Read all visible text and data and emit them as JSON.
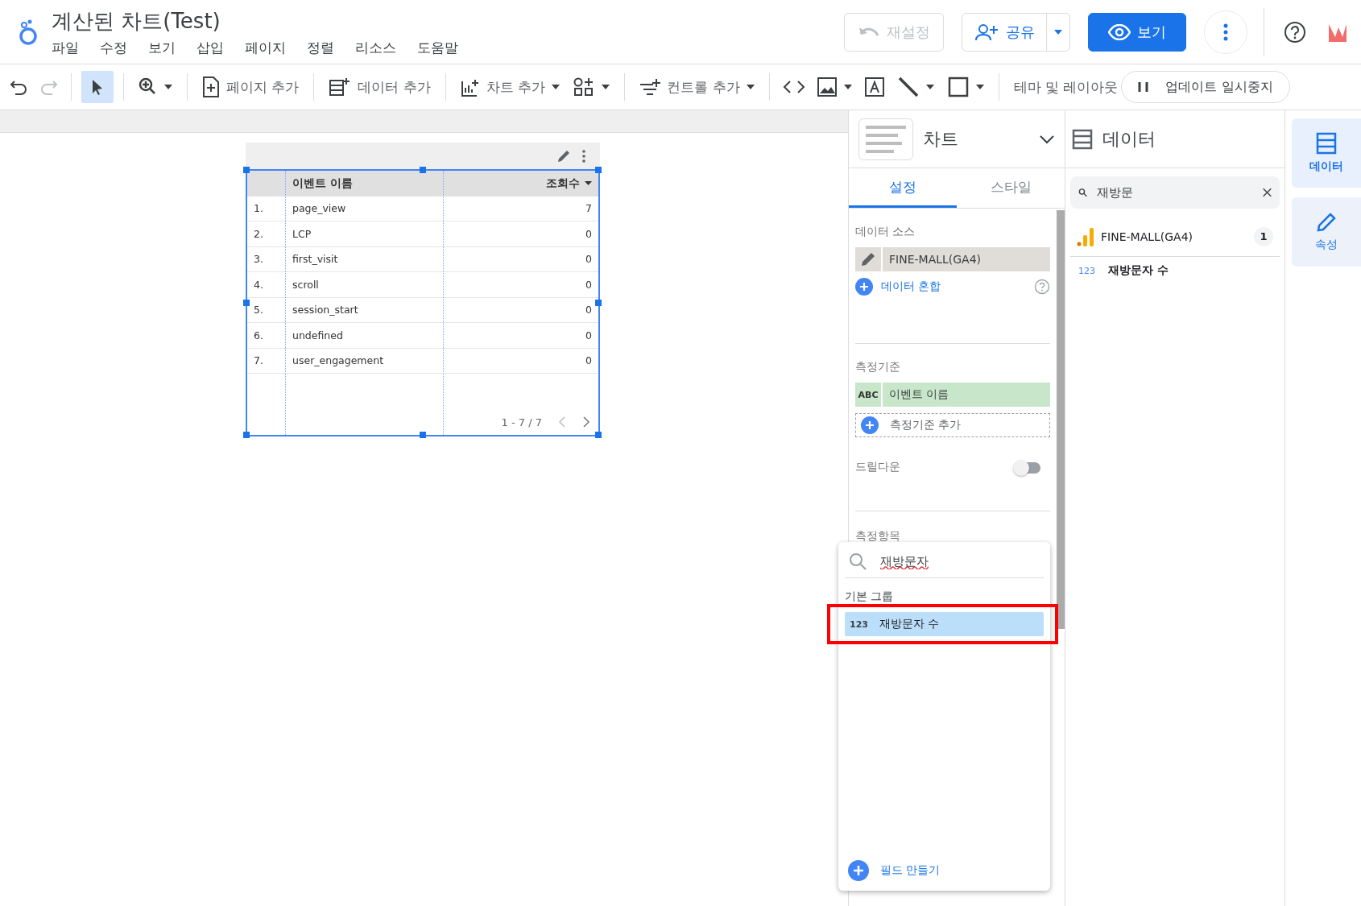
{
  "app": {
    "title": "계산된 차트(Test)",
    "menu": [
      "파일",
      "수정",
      "보기",
      "삽입",
      "페이지",
      "정렬",
      "리소스",
      "도움말"
    ]
  },
  "header_buttons": {
    "reset": "재설정",
    "share": "공유",
    "view": "보기"
  },
  "toolbar": {
    "page_add": "페이지 추가",
    "data_add": "데이터 추가",
    "chart_add": "차트 추가",
    "control_add": "컨트롤 추가",
    "theme": "테마 및 레이아웃",
    "pause": "업데이트 일시중지"
  },
  "table": {
    "selected": true,
    "columns": [
      {
        "label": "이벤트 이름",
        "sorted": false
      },
      {
        "label": "조회수",
        "sorted": true
      }
    ],
    "rows": [
      {
        "index": "1.",
        "name": "page_view",
        "value": "7"
      },
      {
        "index": "2.",
        "name": "LCP",
        "value": "0"
      },
      {
        "index": "3.",
        "name": "first_visit",
        "value": "0"
      },
      {
        "index": "4.",
        "name": "scroll",
        "value": "0"
      },
      {
        "index": "5.",
        "name": "session_start",
        "value": "0"
      },
      {
        "index": "6.",
        "name": "undefined",
        "value": "0"
      },
      {
        "index": "7.",
        "name": "user_engagement",
        "value": "0"
      }
    ],
    "pagination": "1 - 7 / 7"
  },
  "settings_panel": {
    "chart_type": "차트",
    "tabs": [
      {
        "label": "설정",
        "selected": true
      },
      {
        "label": "스타일",
        "selected": false
      }
    ],
    "data_source_label": "데이터 소스",
    "data_source": "FINE-MALL(GA4)",
    "blend": "데이터 혼합",
    "dimension_label": "측정기준",
    "dimension": {
      "type": "ABC",
      "name": "이벤트 이름"
    },
    "add_dimension": "측정기준 추가",
    "drilldown": {
      "label": "드릴다운",
      "on": false
    },
    "metric_label": "측정항목"
  },
  "field_picker": {
    "search": "재방문자",
    "group": "기본 그룹",
    "items": [
      {
        "type": "123",
        "name": "재방문자 수",
        "selected": true
      }
    ],
    "create": "필드 만들기"
  },
  "data_panel": {
    "title": "데이터",
    "search": "재방문",
    "source": {
      "name": "FINE-MALL(GA4)",
      "count": "1"
    },
    "fields": [
      {
        "type": "123",
        "name": "재방문자 수"
      }
    ]
  },
  "rail": [
    {
      "label": "데이터",
      "selected": true
    },
    {
      "label": "속성",
      "selected": false
    }
  ]
}
